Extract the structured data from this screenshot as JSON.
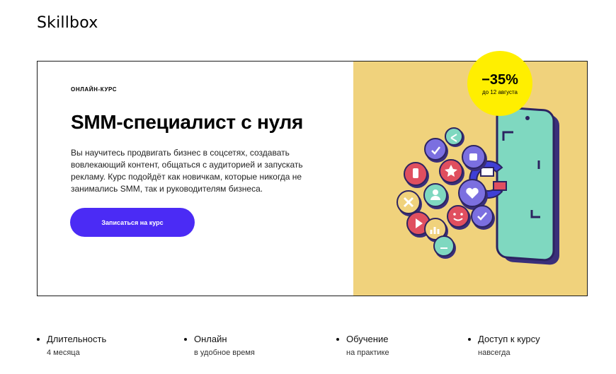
{
  "header": {
    "logo": "Skillbox"
  },
  "hero": {
    "kicker": "ОНЛАЙН-КУРС",
    "title": "SMM-специалист с нуля",
    "description": "Вы научитесь продвигать бизнес в соцсетях, создавать вовлекающий контент, общаться с аудиторией и запускать рекламу. Курс подойдёт как новичкам, которые никогда не занимались SMM, так и руководителям бизнеса.",
    "cta_label": "Записаться на курс",
    "badge": {
      "discount": "−35%",
      "note": "до 12 августа"
    },
    "colors": {
      "accent": "#4b2bf5",
      "panel": "#f0d27c",
      "badge": "#ffef00",
      "phone_screen": "#7fd8c0"
    },
    "illustration_icons": [
      "phone-icon",
      "magnet-icon",
      "like-icon",
      "heart-icon",
      "star-icon",
      "check-icon",
      "smile-icon",
      "user-icon",
      "play-icon",
      "chart-icon",
      "share-icon",
      "close-icon",
      "thumbs-up-icon"
    ]
  },
  "features": [
    {
      "title": "Длительность",
      "subtitle": "4 месяца"
    },
    {
      "title": "Онлайн",
      "subtitle": "в удобное время"
    },
    {
      "title": "Обучение",
      "subtitle": "на практике"
    },
    {
      "title": "Доступ к курсу",
      "subtitle": "навсегда"
    }
  ]
}
